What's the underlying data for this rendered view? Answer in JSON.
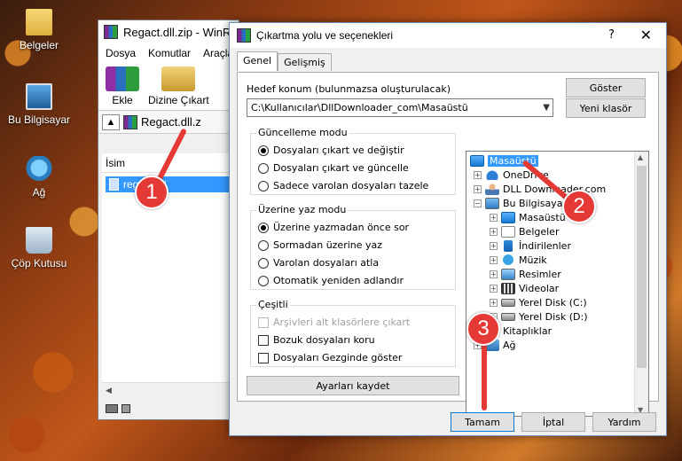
{
  "desktop": {
    "icons": [
      {
        "label": "Belgeler",
        "icon": "folder-icon"
      },
      {
        "label": "Bu Bilgisayar",
        "icon": "computer-icon"
      },
      {
        "label": "Ağ",
        "icon": "network-icon"
      },
      {
        "label": "Çöp Kutusu",
        "icon": "recycle-bin-icon"
      }
    ]
  },
  "winrar": {
    "title": "Regact.dll.zip - WinR",
    "menu": [
      "Dosya",
      "Komutlar",
      "Araçla"
    ],
    "toolbar": {
      "add_label": "Ekle",
      "extract_label": "Dizine Çıkart"
    },
    "path": "Regact.dll.z",
    "list_header": "İsim",
    "selected_file": "regact.dll"
  },
  "dialog": {
    "title": "Çıkartma yolu ve seçenekleri",
    "help_glyph": "?",
    "close_glyph": "✕",
    "tabs": [
      "Genel",
      "Gelişmiş"
    ],
    "target_label": "Hedef konum (bulunmazsa oluşturulacak)",
    "target_value": "C:\\Kullanıcılar\\DllDownloader_com\\Masaüstü",
    "show_button": "Göster",
    "new_folder_button": "Yeni klasör",
    "update_group": {
      "title": "Güncelleme modu",
      "options": [
        "Dosyaları çıkart ve değiştir",
        "Dosyaları çıkart ve güncelle",
        "Sadece varolan dosyaları tazele"
      ],
      "selected": 0
    },
    "overwrite_group": {
      "title": "Üzerine yaz modu",
      "options": [
        "Üzerine yazmadan önce sor",
        "Sormadan üzerine yaz",
        "Varolan dosyaları atla",
        "Otomatik yeniden adlandır"
      ],
      "selected": 0
    },
    "misc_group": {
      "title": "Çeşitli",
      "options": [
        "Arşivleri alt klasörlere çıkart",
        "Bozuk dosyaları koru",
        "Dosyaları Gezginde göster"
      ]
    },
    "save_settings_button": "Ayarları kaydet",
    "tree": {
      "root": "Masaüstü",
      "onedrive": "OneDrive",
      "user": "DLL Downloader.com",
      "this_pc": "Bu Bilgisayar",
      "pc_children": [
        "Masaüstü",
        "Belgeler",
        "İndirilenler",
        "Müzik",
        "Resimler",
        "Videolar",
        "Yerel Disk (C:)",
        "Yerel Disk (D:)"
      ],
      "libraries": "Kitaplıklar",
      "network": "Ağ"
    },
    "ok_button": "Tamam",
    "cancel_button": "İptal",
    "help_button": "Yardım"
  },
  "annotations": [
    "1",
    "2",
    "3"
  ],
  "colors": {
    "annotation": "#e53935",
    "selection": "#3399ff"
  }
}
